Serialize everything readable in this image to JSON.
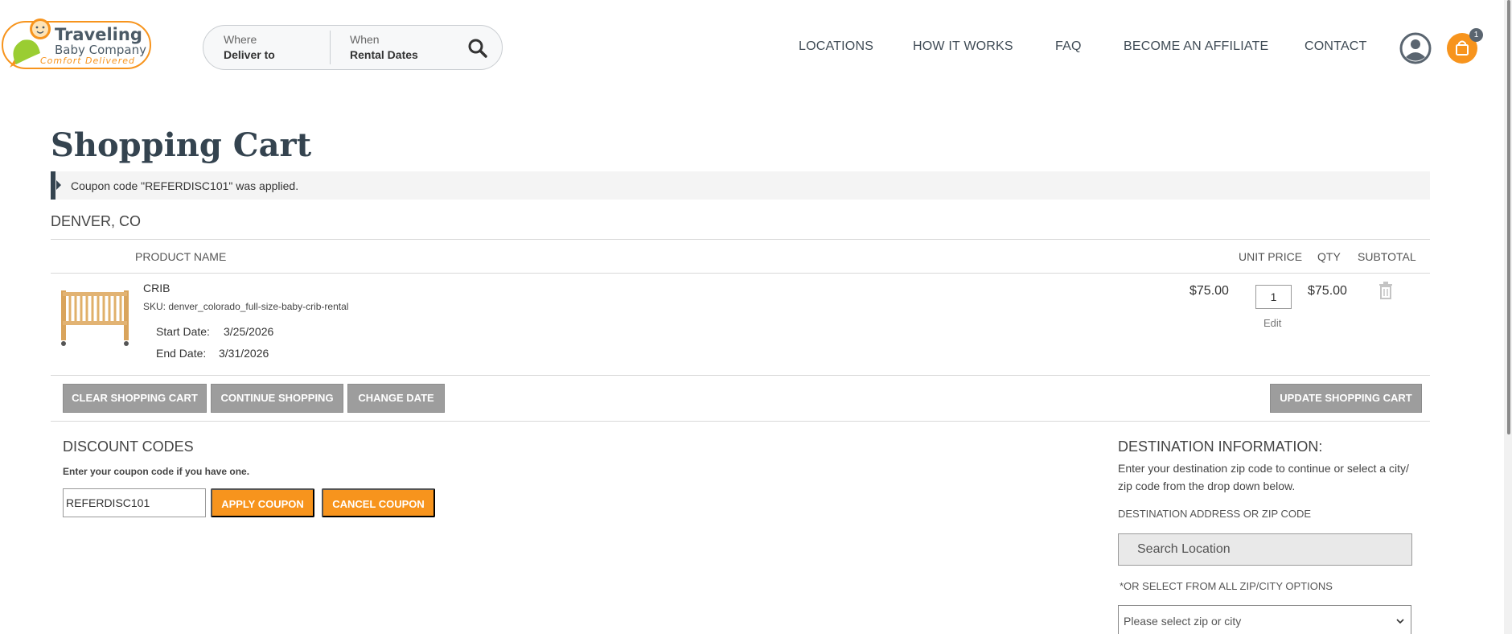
{
  "header": {
    "logo": {
      "line1": "Traveling",
      "line2": "Baby Company",
      "tagline": "Comfort Delivered"
    },
    "search": {
      "where_label": "Where",
      "where_value": "Deliver to",
      "when_label": "When",
      "when_value": "Rental Dates",
      "icon": "search-icon"
    },
    "nav": [
      "LOCATIONS",
      "HOW IT WORKS",
      "FAQ",
      "BECOME AN AFFILIATE",
      "CONTACT"
    ],
    "user_icon": "user-circle-icon",
    "cart_icon": "shopping-bag-icon",
    "cart_count": "1"
  },
  "page": {
    "title": "Shopping Cart",
    "notice": "Coupon code \"REFERDISC101\" was applied.",
    "location": "DENVER, CO"
  },
  "cart": {
    "columns": {
      "product": "PRODUCT NAME",
      "unit_price": "UNIT PRICE",
      "qty": "QTY",
      "subtotal": "SUBTOTAL"
    },
    "items": [
      {
        "name": "CRIB",
        "sku": "SKU: denver_colorado_full-size-baby-crib-rental",
        "start_label": "Start Date:",
        "start_value": "3/25/2026",
        "end_label": "End Date:",
        "end_value": "3/31/2026",
        "unit_price": "$75.00",
        "qty": "1",
        "edit_label": "Edit",
        "subtotal": "$75.00",
        "image": "crib-image"
      }
    ],
    "buttons": {
      "clear": "CLEAR SHOPPING CART",
      "continue": "CONTINUE SHOPPING",
      "change_date": "CHANGE DATE",
      "update": "UPDATE SHOPPING CART"
    }
  },
  "discount": {
    "heading": "DISCOUNT CODES",
    "subtitle": "Enter your coupon code if you have one.",
    "code_value": "REFERDISC101",
    "apply_label": "APPLY COUPON",
    "cancel_label": "CANCEL COUPON"
  },
  "destination": {
    "heading": "DESTINATION INFORMATION:",
    "description": "Enter your destination zip code to continue or select a city/ zip code from the drop down below.",
    "address_label": "DESTINATION ADDRESS OR ZIP CODE",
    "search_placeholder": "Search Location",
    "select_label": "*OR SELECT FROM ALL ZIP/CITY OPTIONS",
    "select_value": "Please select zip or city"
  },
  "colors": {
    "accent": "#f7941d",
    "heading": "#34434f",
    "gray_button": "#9d9d9d"
  }
}
